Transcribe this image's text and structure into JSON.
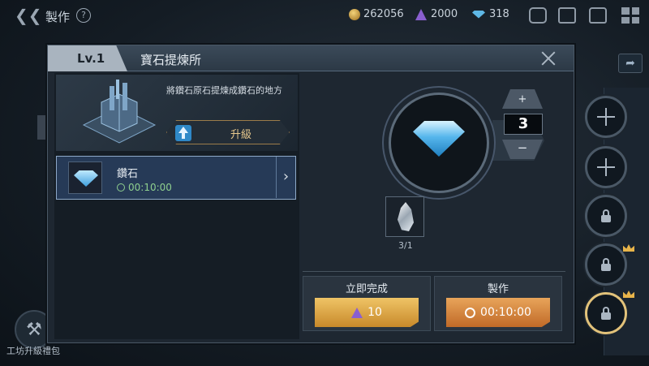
{
  "topbar": {
    "title": "製作",
    "help": "?",
    "gold": "262056",
    "crystal": "2000",
    "diamond": "318"
  },
  "icons": {
    "back": "back-arrow-icon",
    "chat": "chat-icon",
    "mail": "mail-icon",
    "bag": "backpack-icon",
    "menu": "grid-menu-icon"
  },
  "left_bottom": {
    "package_label": "工坊升級禮包"
  },
  "dialog": {
    "level": "Lv.1",
    "title": "寶石提煉所",
    "description": "將鑽石原石提煉成鑽石的地方",
    "upgrade_label": "升級",
    "item": {
      "name": "鑽石",
      "time": "00:10:00"
    },
    "quantity": "3",
    "qty_plus": "+",
    "qty_minus": "−",
    "material_count": "3/1",
    "instant": {
      "label": "立即完成",
      "cost": "10"
    },
    "craft": {
      "label": "製作",
      "time": "00:10:00"
    }
  },
  "colors": {
    "accent_orange": "#c06a28",
    "gold_border": "#e2c27a",
    "timer_green": "#8fd08f",
    "panel_bg": "#1e2731"
  }
}
